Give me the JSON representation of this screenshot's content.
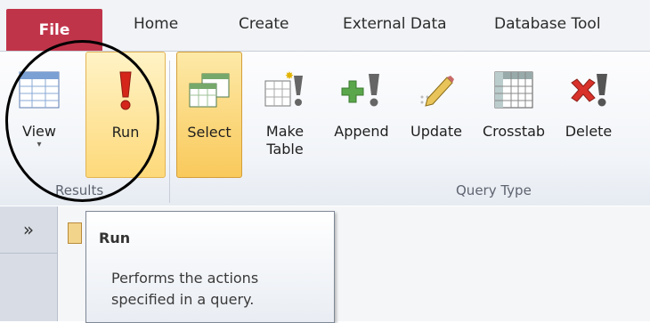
{
  "tabs": {
    "file": "File",
    "home": "Home",
    "create": "Create",
    "external_data": "External Data",
    "database_tools": "Database Tool"
  },
  "ribbon": {
    "results": {
      "view": "View",
      "run": "Run",
      "group_label": "Results"
    },
    "query_type": {
      "select": "Select",
      "make_table_1": "Make",
      "make_table_2": "Table",
      "append": "Append",
      "update": "Update",
      "crosstab": "Crosstab",
      "delete": "Delete",
      "group_label": "Query Type"
    }
  },
  "nav": {
    "expand_label": "»"
  },
  "tooltip": {
    "title": "Run",
    "body": "Performs the actions specified in a query."
  },
  "colors": {
    "file_tab": "#c0344a",
    "highlight": "#fdd97a",
    "run_icon": "#d4261a"
  }
}
